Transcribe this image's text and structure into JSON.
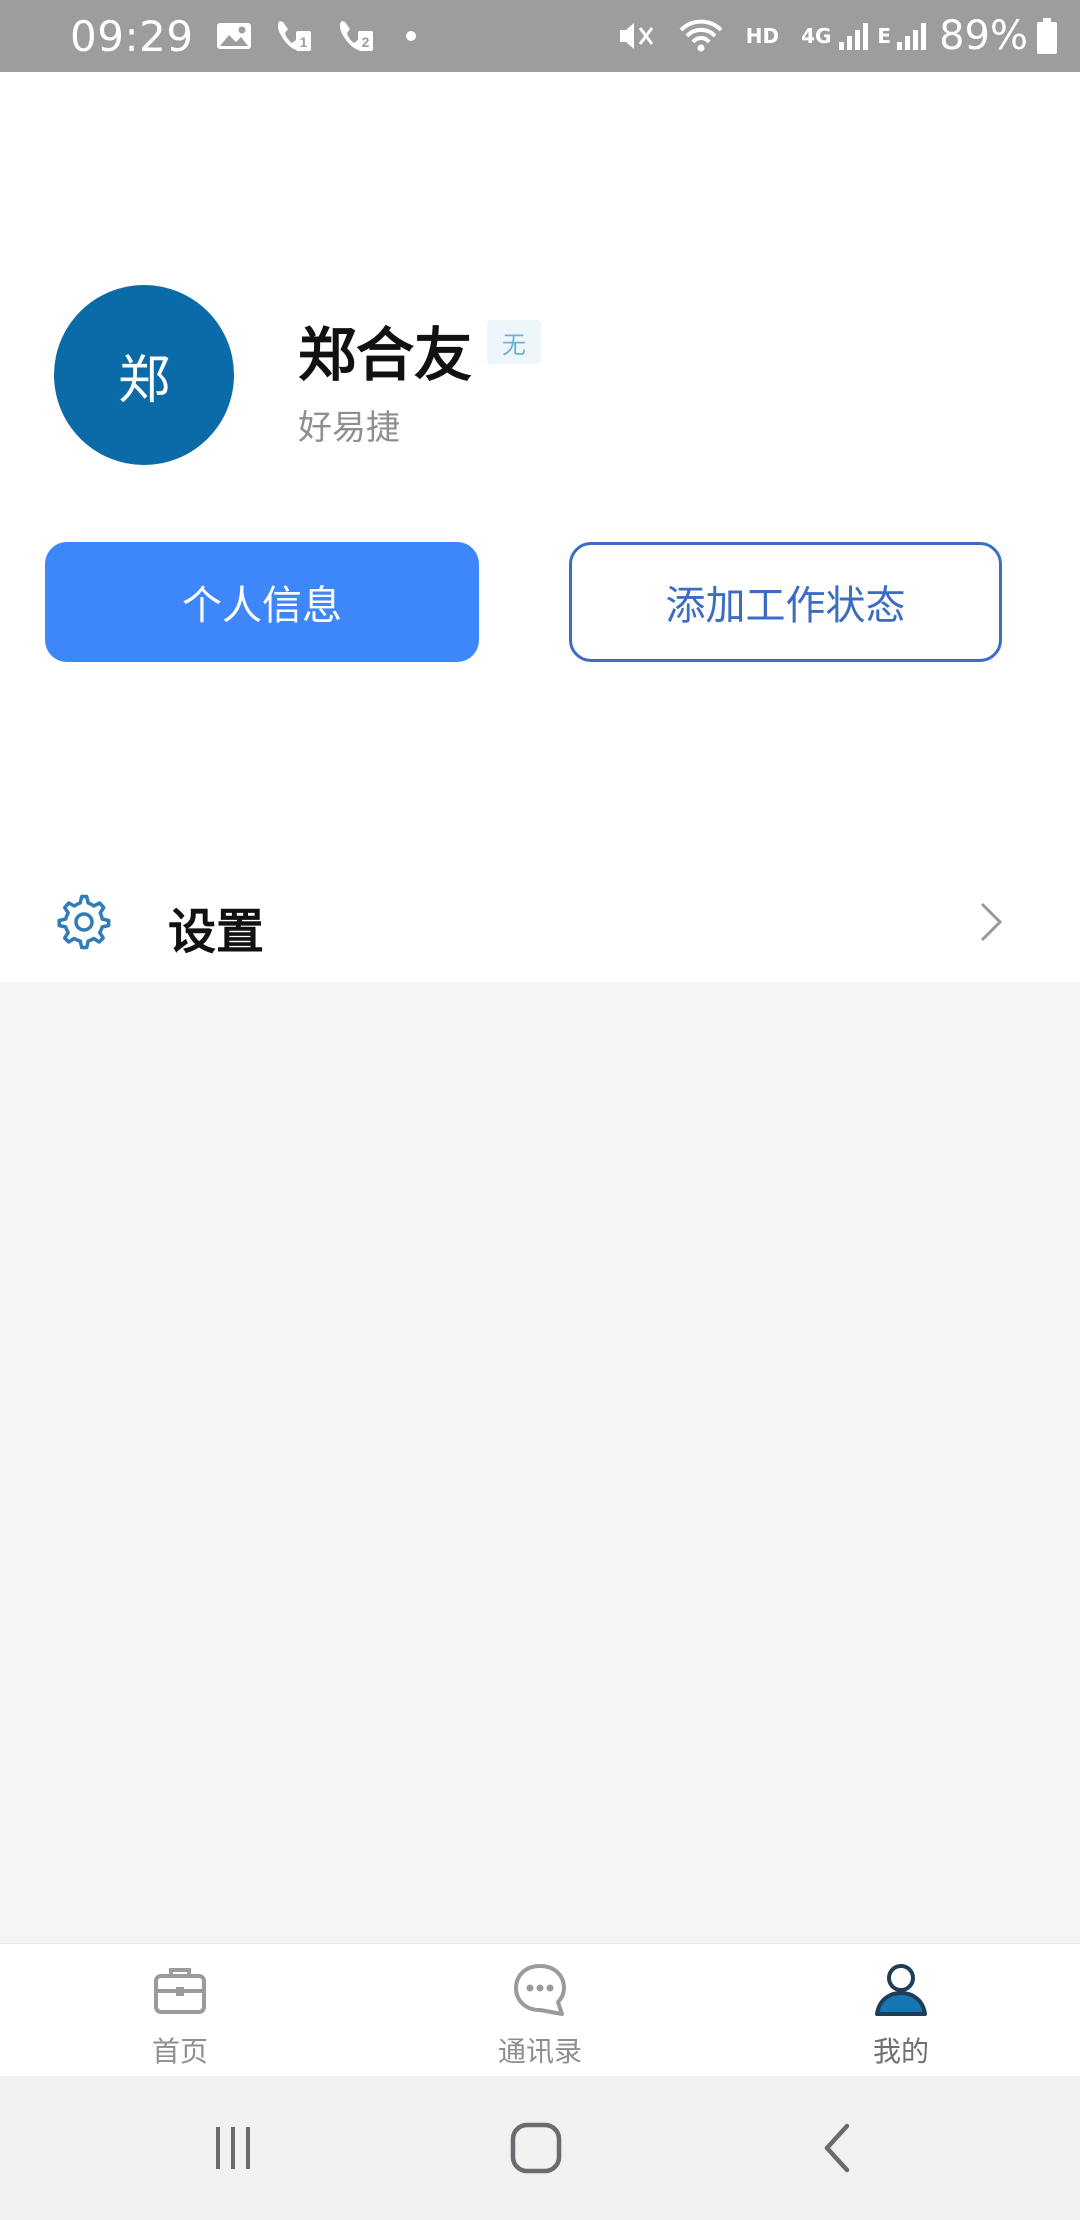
{
  "status_bar": {
    "time": "09:29",
    "network_hd": "HD",
    "network_4g": "4G",
    "network_e": "E",
    "battery": "89%"
  },
  "profile": {
    "avatar_text": "郑",
    "name": "郑合友",
    "badge": "无",
    "company": "好易捷"
  },
  "actions": {
    "personal_info": "个人信息",
    "add_work_status": "添加工作状态"
  },
  "settings": {
    "label": "设置"
  },
  "tabs": [
    {
      "label": "首页",
      "icon": "briefcase-icon"
    },
    {
      "label": "通讯录",
      "icon": "chat-bubble-icon"
    },
    {
      "label": "我的",
      "icon": "person-icon",
      "active": true
    }
  ],
  "colors": {
    "primary": "#3d87fb",
    "avatar": "#0b6aa8",
    "outline": "#3c6dc2",
    "active_tab": "#1576b3"
  }
}
